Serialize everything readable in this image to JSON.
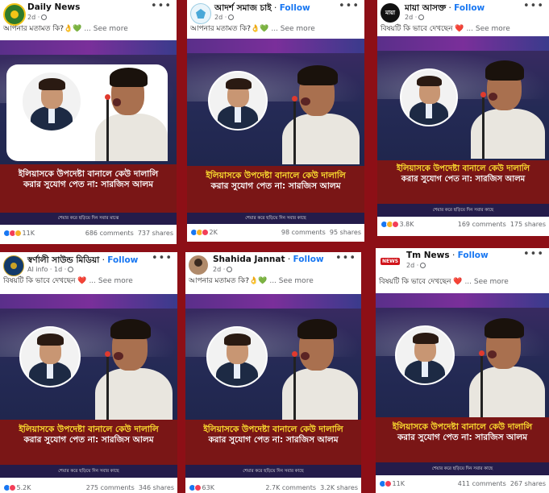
{
  "posts": [
    {
      "page": "Daily News",
      "follow": "",
      "time": "2d",
      "caption_text": "আপনার মতামত কি?",
      "caption_emoji": "👌💚",
      "see_more": "... See more",
      "headline_1": "ইলিয়াসকে উপদেষ্টা বানালে কেউ দালালি",
      "headline_2": "করার সুযোগ পেত না: সারজিস আলম",
      "footer": "শেয়ার করে ছড়িয়ে দিন সবার মাঝে",
      "reactions": "11K",
      "comments": "686 comments",
      "shares": "737 shares",
      "avatar_icon": "daily-news-logo-icon"
    },
    {
      "page": "আদর্শ সমাজ চাই",
      "follow": "Follow",
      "time": "2d",
      "caption_text": "আপনার মতামত কি?",
      "caption_emoji": "👌💚",
      "see_more": "... See more",
      "headline_1": "ইলিয়াসকে উপদেষ্টা বানালে কেউ দালালি",
      "headline_2": "করার সুযোগ পেত না: সারজিস আলম",
      "footer": "শেয়ার করে ছড়িয়ে দিন সবার কাছে",
      "reactions": "2K",
      "comments": "98 comments",
      "shares": "95 shares",
      "avatar_icon": "pentagon-logo-icon"
    },
    {
      "page": "মায়া আসক্ত",
      "follow": "Follow",
      "time": "2d",
      "caption_text": "বিষয়টি কি ভাবে দেখছেন",
      "caption_emoji": "❤️",
      "see_more": "... See more",
      "headline_1": "ইলিয়াসকে উপদেষ্টা বানালে কেউ দালালি",
      "headline_2": "করার সুযোগ পেত না: সারজিস আলম",
      "footer": "শেয়ার করে ছড়িয়ে দিন সবার কাছে",
      "reactions": "3.8K",
      "comments": "169 comments",
      "shares": "175 shares",
      "avatar_icon": "maya-logo-icon"
    },
    {
      "page": "স্বর্ণালী সাউন্ড মিডিয়া",
      "follow": "Follow",
      "time": "AI info · 1d",
      "caption_text": "বিষয়টি কি ভাবে দেখছেন",
      "caption_emoji": "❤️",
      "see_more": "... See more",
      "headline_1": "ইলিয়াসকে উপদেষ্টা বানালে কেউ দালালি",
      "headline_2": "করার সুযোগ পেত না: সারজিস আলম",
      "footer": "শেয়ার করে ছড়িয়ে দিন সবার কাছে",
      "reactions": "5.2K",
      "comments": "275 comments",
      "shares": "346 shares",
      "avatar_icon": "sound-media-logo-icon"
    },
    {
      "page": "Shahida Jannat",
      "follow": "Follow",
      "time": "2d",
      "caption_text": "আপনার মতামত কি?",
      "caption_emoji": "👌💚",
      "see_more": "... See more",
      "headline_1": "ইলিয়াসকে উপদেষ্টা বানালে কেউ দালালি",
      "headline_2": "করার সুযোগ পেত না: সারজিস আলম",
      "footer": "শেয়ার করে ছড়িয়ে দিন সবার কাছে",
      "reactions": "63K",
      "comments": "2.7K comments",
      "shares": "3.2K shares",
      "avatar_icon": "profile-photo-icon"
    },
    {
      "page": "Tm News",
      "follow": "Follow",
      "time": "2d",
      "caption_text": "বিষয়টি কি ভাবে দেখছেন",
      "caption_emoji": "❤️",
      "see_more": "... See more",
      "headline_1": "ইলিয়াসকে উপদেষ্টা বানালে কেউ দালালি",
      "headline_2": "করার সুযোগ পেত না: সারজিস আলম",
      "footer": "শেয়ার করে ছড়িয়ে দিন সবার কাছে",
      "reactions": "11K",
      "comments": "411 comments",
      "shares": "267 shares",
      "avatar_icon": "tm-news-logo-icon",
      "avatar_badge": "NEWS"
    }
  ],
  "colors": {
    "background": "#8d0f16",
    "follow": "#1877f2",
    "headline_bar": "#7a1616",
    "headline_yellow": "#ffe230"
  }
}
